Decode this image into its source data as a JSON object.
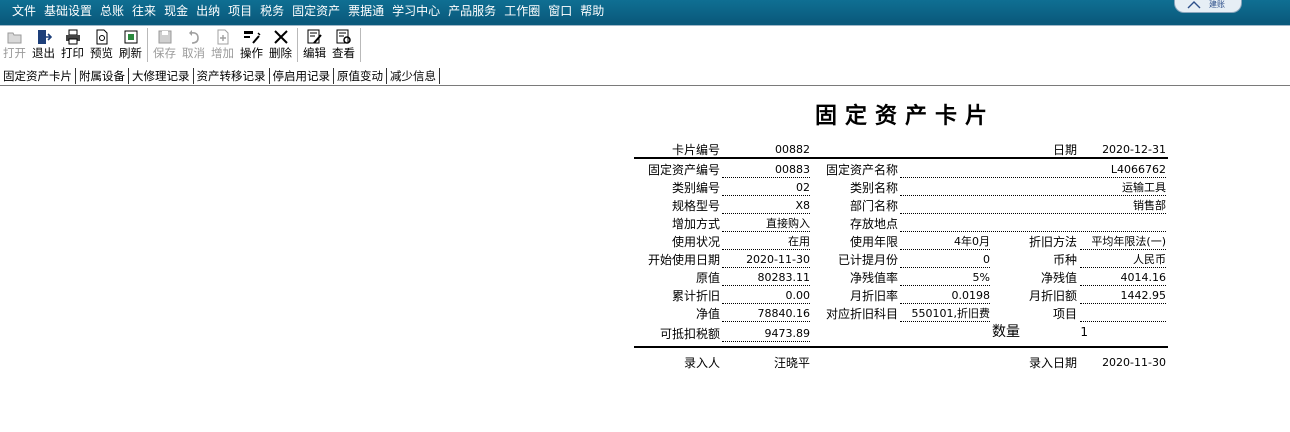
{
  "menu": [
    "文件",
    "基础设置",
    "总账",
    "往来",
    "现金",
    "出纳",
    "项目",
    "税务",
    "固定资产",
    "票据通",
    "学习中心",
    "产品服务",
    "工作圈",
    "窗口",
    "帮助"
  ],
  "logo": {
    "text": "建账"
  },
  "toolbar": {
    "open": "打开",
    "exit": "退出",
    "print": "打印",
    "preview": "预览",
    "refresh": "刷新",
    "save": "保存",
    "cancel": "取消",
    "add": "增加",
    "operate": "操作",
    "delete": "删除",
    "edit": "编辑",
    "view": "查看"
  },
  "tabs": [
    "固定资产卡片",
    "附属设备",
    "大修理记录",
    "资产转移记录",
    "停启用记录",
    "原值变动",
    "减少信息"
  ],
  "card": {
    "title": "固定资产卡片",
    "card_no_label": "卡片编号",
    "card_no": "00882",
    "date_label": "日期",
    "date": "2020-12-31",
    "asset_no_label": "固定资产编号",
    "asset_no": "00883",
    "asset_name_label": "固定资产名称",
    "asset_name": "L4066762",
    "cat_no_label": "类别编号",
    "cat_no": "02",
    "cat_name_label": "类别名称",
    "cat_name": "运输工具",
    "spec_label": "规格型号",
    "spec": "X8",
    "dept_label": "部门名称",
    "dept": "销售部",
    "add_method_label": "增加方式",
    "add_method": "直接购入",
    "location_label": "存放地点",
    "location": "",
    "status_label": "使用状况",
    "status": "在用",
    "life_label": "使用年限",
    "life": "4年0月",
    "dep_method_label": "折旧方法",
    "dep_method": "平均年限法(一)",
    "start_label": "开始使用日期",
    "start": "2020-11-30",
    "months_label": "已计提月份",
    "months": "0",
    "currency_label": "币种",
    "currency": "人民币",
    "orig_label": "原值",
    "orig": "80283.11",
    "salv_rate_label": "净残值率",
    "salv_rate": "5%",
    "salv_label": "净残值",
    "salv": "4014.16",
    "acc_dep_label": "累计折旧",
    "acc_dep": "0.00",
    "mon_rate_label": "月折旧率",
    "mon_rate": "0.0198",
    "mon_amt_label": "月折旧额",
    "mon_amt": "1442.95",
    "net_label": "净值",
    "net": "78840.16",
    "dep_subject_label": "对应折旧科目",
    "dep_subject": "550101,折旧费",
    "project_label": "项目",
    "project": "",
    "tax_label": "可抵扣税额",
    "tax": "9473.89",
    "qty_label": "数量",
    "qty": "1",
    "entry_person_label": "录入人",
    "entry_person": "汪晓平",
    "entry_date_label": "录入日期",
    "entry_date": "2020-11-30"
  }
}
